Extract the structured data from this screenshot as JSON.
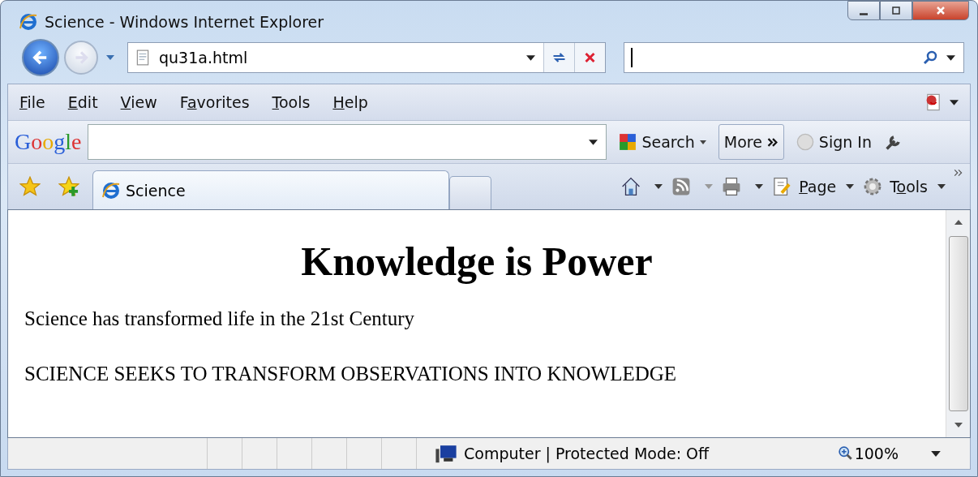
{
  "window": {
    "title": "Science - Windows Internet Explorer"
  },
  "address_bar": {
    "value": "qu31a.html"
  },
  "menu": [
    {
      "key": "F",
      "post": "ile"
    },
    {
      "key": "E",
      "post": "dit"
    },
    {
      "key": "V",
      "post": "iew"
    },
    {
      "pre": "F",
      "key": "a",
      "post": "vorites"
    },
    {
      "key": "T",
      "post": "ools"
    },
    {
      "key": "H",
      "post": "elp"
    }
  ],
  "google_bar": {
    "logo": "Google",
    "search_label": "Search",
    "more_label": "More",
    "sign_in_label": "Sign In"
  },
  "tabs": [
    {
      "label": "Science",
      "selected": true
    }
  ],
  "command_bar": [
    {
      "kind": "home"
    },
    {
      "kind": "feeds"
    },
    {
      "kind": "print"
    },
    {
      "kind": "page",
      "key": "P",
      "post": "age"
    },
    {
      "kind": "tools",
      "pre": "T",
      "key": "o",
      "post": "ols"
    }
  ],
  "page": {
    "heading": "Knowledge is Power",
    "paragraphs": [
      "Science has transformed life in the 21st Century",
      "SCIENCE SEEKS TO TRANSFORM OBSERVATIONS INTO KNOWLEDGE"
    ]
  },
  "status_bar": {
    "zone": "Computer | Protected Mode: Off",
    "zoom": "100%"
  }
}
